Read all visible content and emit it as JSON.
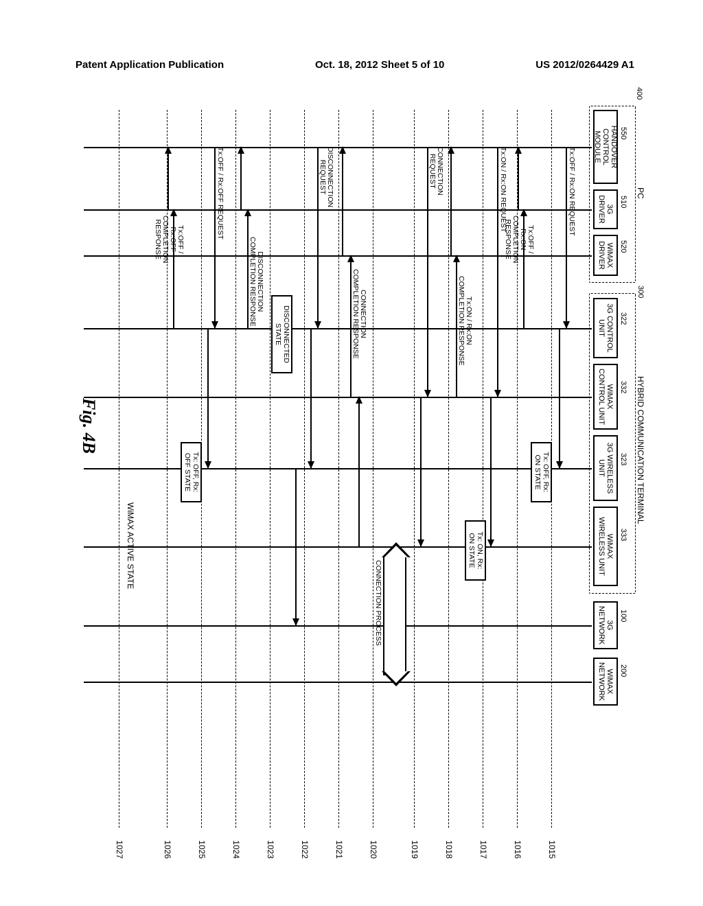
{
  "header": {
    "left": "Patent Application Publication",
    "center": "Oct. 18, 2012  Sheet 5 of 10",
    "right": "US 2012/0264429 A1"
  },
  "groups": {
    "pc": {
      "ref": "400",
      "label": "PC"
    },
    "terminal": {
      "ref": "300",
      "label": "HYBRID COMMUNICATION TERMINAL"
    }
  },
  "lanes": {
    "handover": {
      "ref": "550",
      "label": "HANDOVER\nCONTROL MODULE"
    },
    "drv3g": {
      "ref": "510",
      "label": "3G\nDRIVER"
    },
    "drvwimax": {
      "ref": "520",
      "label": "WiMAX\nDRIVER"
    },
    "ctl3g": {
      "ref": "322",
      "label": "3G CONTROL\nUNIT"
    },
    "ctlwimax": {
      "ref": "332",
      "label": "WiMAX\nCONTROL UNIT"
    },
    "wl3g": {
      "ref": "323",
      "label": "3G WIRELESS\nUNIT"
    },
    "wlwimax": {
      "ref": "333",
      "label": "WiMAX\nWIRELESS UNIT"
    },
    "net3g": {
      "ref": "100",
      "label": "3G\nNETWORK"
    },
    "netwimax": {
      "ref": "200",
      "label": "WiMAX\nNETWORK"
    }
  },
  "messages": {
    "m15a": "Tx:OFF / Rx:ON REQUEST",
    "m16a": "Tx:OFF / Rx:ON\nCOMPLETION RESPONSE",
    "m17a": "Tx:ON / Rx:ON REQUEST",
    "m18a": "Tx:ON / Rx:ON\nCOMPLETION RESPONSE",
    "m19a": "CONNECTION\nREQUEST",
    "m20label": "CONNECTION PROCESS",
    "m21a": "CONNECTION\nCOMPLETION RESPONSE",
    "m22a": "DISCONNECTION\nREQUEST",
    "m23b": "DISCONNECTED\nSTATE",
    "m24a": "DISCONNECTION\nCOMPLETION RESPONSE",
    "m25a": "Tx:OFF / Rx:OFF REQUEST",
    "m26a": "Tx:OFF / Rx:OFF\nCOMPLETION RESPONSE",
    "m27label": "WiMAX ACTIVE STATE"
  },
  "states": {
    "s3g_on": "Tx: OFF, Rx:\nON STATE",
    "s_wm_on": "Tx: ON, Rx:\nON STATE",
    "s3g_off": "Tx: OFF, Rx:\nOFF STATE"
  },
  "steps": [
    "1015",
    "1016",
    "1017",
    "1018",
    "1019",
    "1020",
    "1021",
    "1022",
    "1023",
    "1024",
    "1025",
    "1026",
    "1027"
  ],
  "figure_label": "Fig. 4B"
}
